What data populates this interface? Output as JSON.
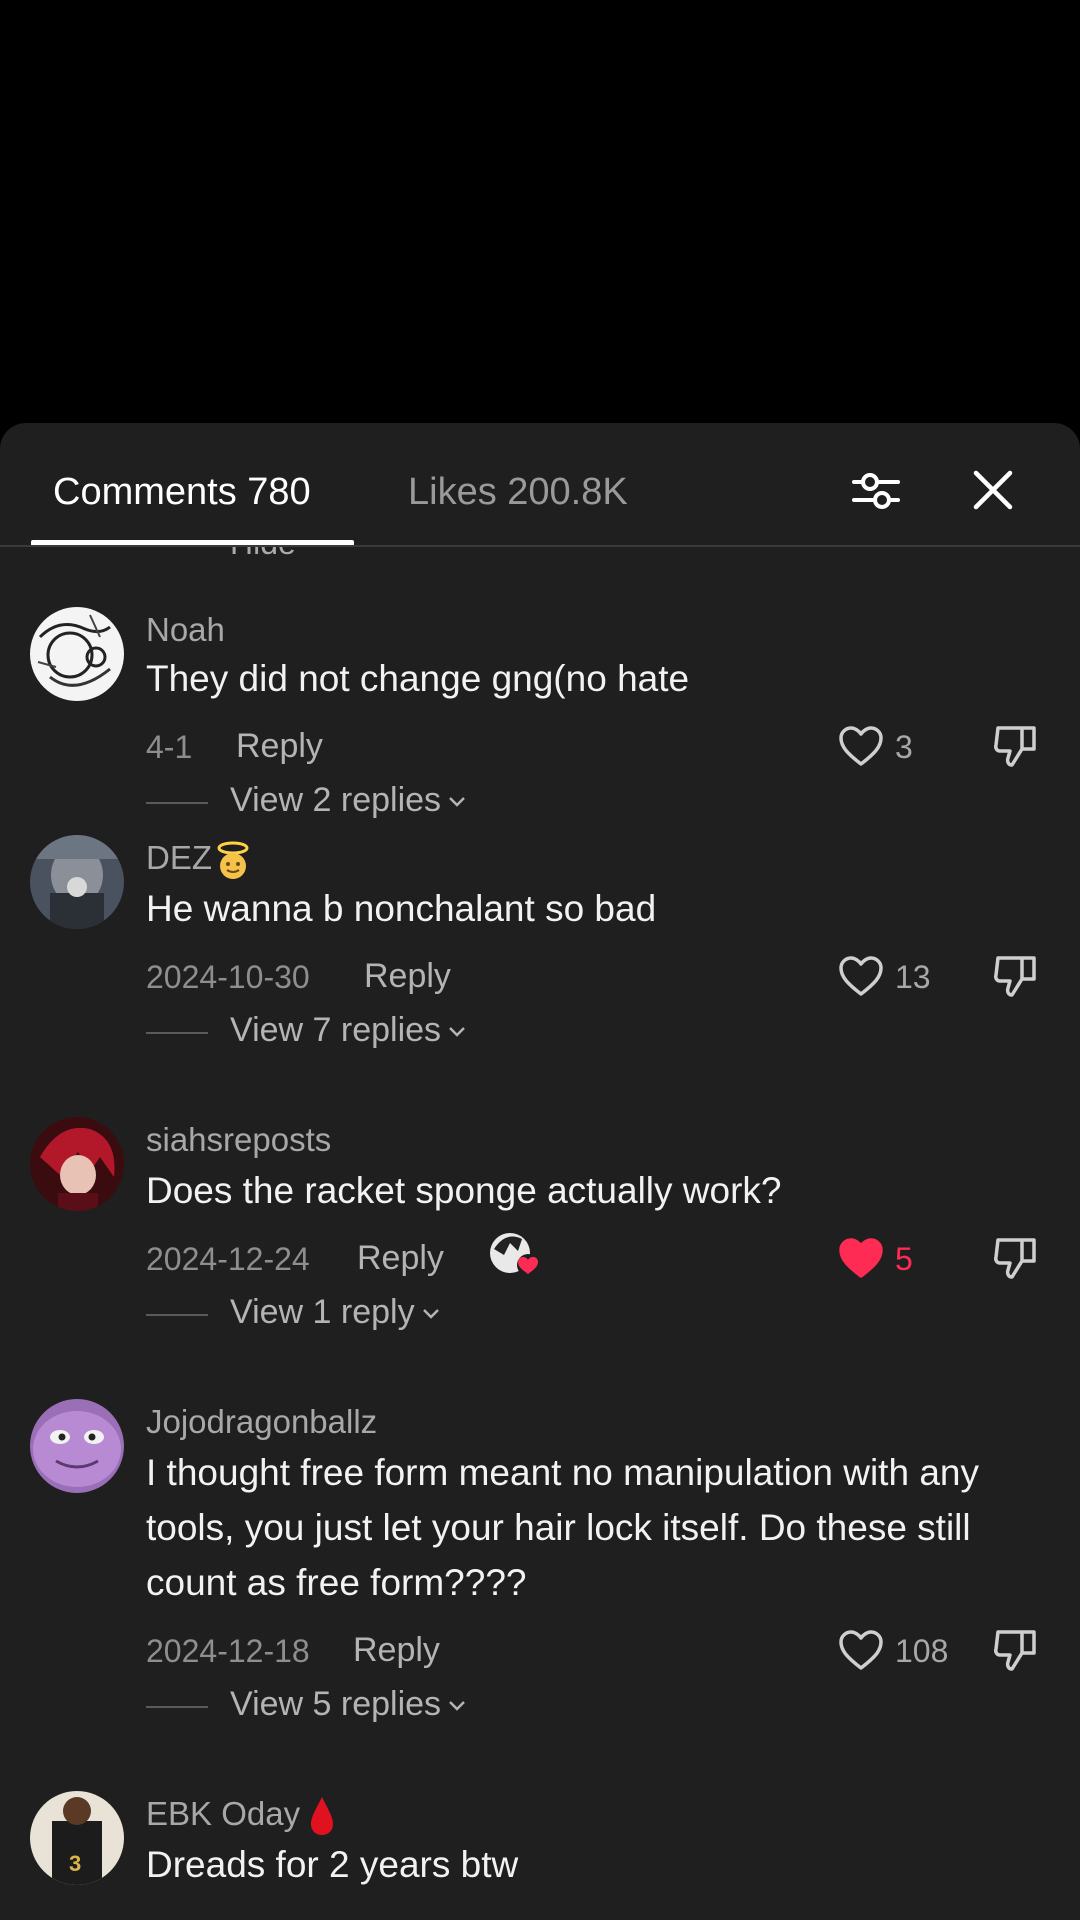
{
  "tabs": {
    "comments": "Comments 780",
    "likes": "Likes 200.8K"
  },
  "list": {
    "hide_label": "Hide",
    "comments": [
      {
        "username": "Noah",
        "text": "They did not change gng(no hate",
        "date": "4-1",
        "reply": "Reply",
        "likes": "3",
        "liked": false,
        "view_replies": "View 2 replies"
      },
      {
        "username": "DEZ",
        "username_emoji": "angel-face-emoji",
        "text": "He wanna b nonchalant so bad",
        "date": "2024-10-30",
        "reply": "Reply",
        "likes": "13",
        "liked": false,
        "view_replies": "View 7 replies"
      },
      {
        "username": "siahsreposts",
        "text": "Does the racket sponge actually work?",
        "date": "2024-12-24",
        "reply": "Reply",
        "likes": "5",
        "liked": true,
        "creator_liked": true,
        "view_replies": "View 1 reply"
      },
      {
        "username": "Jojodragonballz",
        "text": "I thought free form meant no manipulation with any tools, you just let your hair lock itself. Do these still count as free form????",
        "date": "2024-12-18",
        "reply": "Reply",
        "likes": "108",
        "liked": false,
        "view_replies": "View 5 replies"
      },
      {
        "username": "EBK Oday",
        "username_emoji": "blood-drop-emoji",
        "text": "Dreads for 2 years btw"
      }
    ]
  },
  "colors": {
    "sheet": "#1f1f1f",
    "accent_liked": "#fe2c55",
    "muted": "#8e8e8e"
  },
  "icons": [
    "filter-sliders-icon",
    "close-icon",
    "heart-icon",
    "dislike-icon",
    "chevron-down-icon"
  ]
}
